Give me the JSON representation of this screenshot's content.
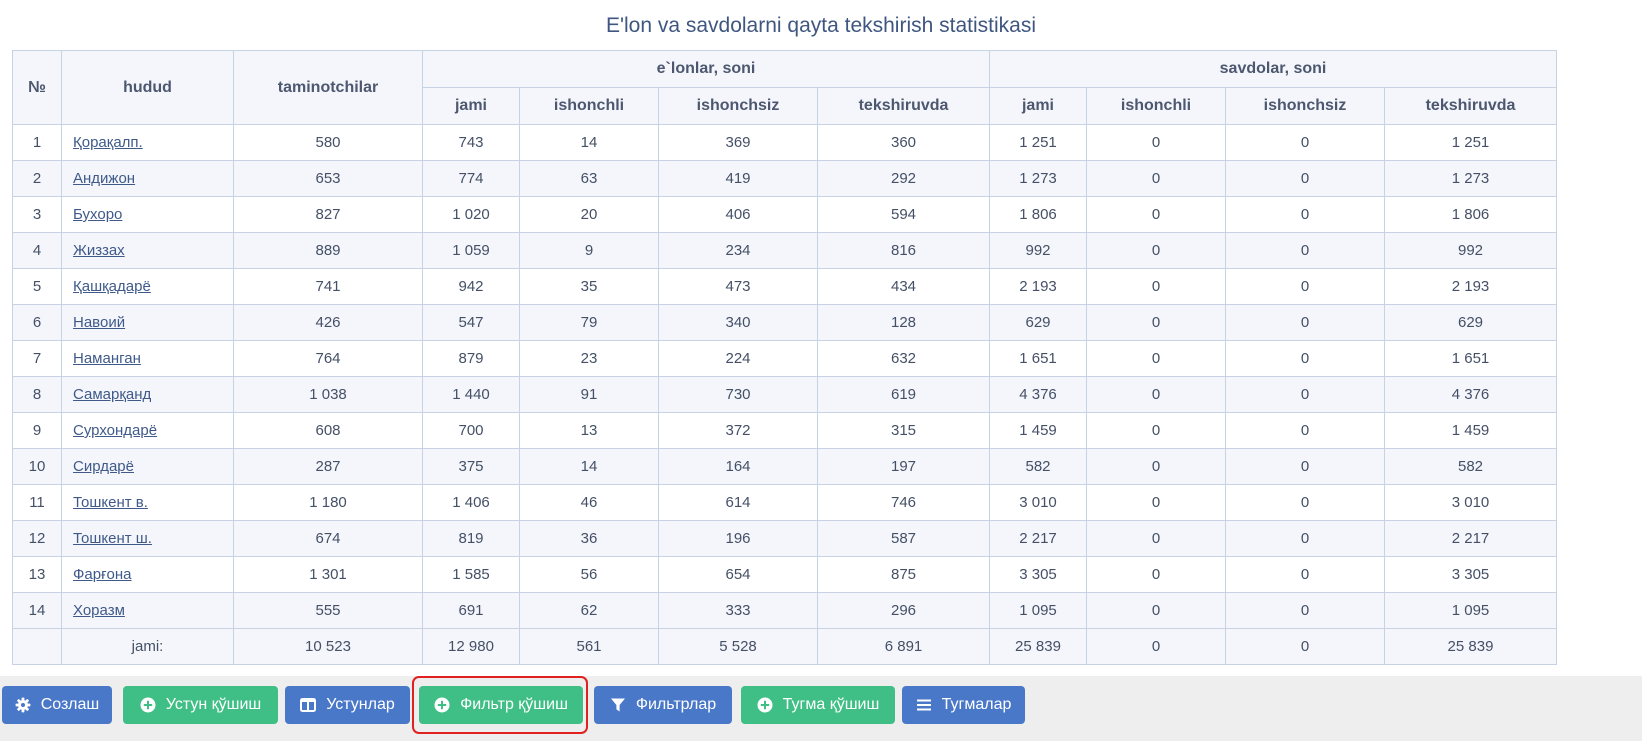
{
  "title": "E'lon va savdolarni qayta tekshirish statistikasi",
  "table": {
    "headers": {
      "num": "№",
      "region": "hudud",
      "suppliers": "taminotchilar",
      "ads_group": "e`lonlar, soni",
      "trades_group": "savdolar, soni",
      "total": "jami",
      "trusted": "ishonchli",
      "untrusted": "ishonchsiz",
      "checking": "tekshiruvda"
    },
    "rows": [
      {
        "n": "1",
        "region": "Қорақалп.",
        "suppliers": "580",
        "ads": [
          "743",
          "14",
          "369",
          "360"
        ],
        "trades": [
          "1 251",
          "0",
          "0",
          "1 251"
        ]
      },
      {
        "n": "2",
        "region": "Андижон",
        "suppliers": "653",
        "ads": [
          "774",
          "63",
          "419",
          "292"
        ],
        "trades": [
          "1 273",
          "0",
          "0",
          "1 273"
        ]
      },
      {
        "n": "3",
        "region": "Бухоро",
        "suppliers": "827",
        "ads": [
          "1 020",
          "20",
          "406",
          "594"
        ],
        "trades": [
          "1 806",
          "0",
          "0",
          "1 806"
        ]
      },
      {
        "n": "4",
        "region": "Жиззах",
        "suppliers": "889",
        "ads": [
          "1 059",
          "9",
          "234",
          "816"
        ],
        "trades": [
          "992",
          "0",
          "0",
          "992"
        ]
      },
      {
        "n": "5",
        "region": "Қашқадарё",
        "suppliers": "741",
        "ads": [
          "942",
          "35",
          "473",
          "434"
        ],
        "trades": [
          "2 193",
          "0",
          "0",
          "2 193"
        ]
      },
      {
        "n": "6",
        "region": "Навоий",
        "suppliers": "426",
        "ads": [
          "547",
          "79",
          "340",
          "128"
        ],
        "trades": [
          "629",
          "0",
          "0",
          "629"
        ]
      },
      {
        "n": "7",
        "region": "Наманган",
        "suppliers": "764",
        "ads": [
          "879",
          "23",
          "224",
          "632"
        ],
        "trades": [
          "1 651",
          "0",
          "0",
          "1 651"
        ]
      },
      {
        "n": "8",
        "region": "Самарқанд",
        "suppliers": "1 038",
        "ads": [
          "1 440",
          "91",
          "730",
          "619"
        ],
        "trades": [
          "4 376",
          "0",
          "0",
          "4 376"
        ]
      },
      {
        "n": "9",
        "region": "Сурхондарё",
        "suppliers": "608",
        "ads": [
          "700",
          "13",
          "372",
          "315"
        ],
        "trades": [
          "1 459",
          "0",
          "0",
          "1 459"
        ]
      },
      {
        "n": "10",
        "region": "Сирдарё",
        "suppliers": "287",
        "ads": [
          "375",
          "14",
          "164",
          "197"
        ],
        "trades": [
          "582",
          "0",
          "0",
          "582"
        ]
      },
      {
        "n": "11",
        "region": "Тошкент в.",
        "suppliers": "1 180",
        "ads": [
          "1 406",
          "46",
          "614",
          "746"
        ],
        "trades": [
          "3 010",
          "0",
          "0",
          "3 010"
        ]
      },
      {
        "n": "12",
        "region": "Тошкент ш.",
        "suppliers": "674",
        "ads": [
          "819",
          "36",
          "196",
          "587"
        ],
        "trades": [
          "2 217",
          "0",
          "0",
          "2 217"
        ]
      },
      {
        "n": "13",
        "region": "Фарғона",
        "suppliers": "1 301",
        "ads": [
          "1 585",
          "56",
          "654",
          "875"
        ],
        "trades": [
          "3 305",
          "0",
          "0",
          "3 305"
        ]
      },
      {
        "n": "14",
        "region": "Хоразм",
        "suppliers": "555",
        "ads": [
          "691",
          "62",
          "333",
          "296"
        ],
        "trades": [
          "1 095",
          "0",
          "0",
          "1 095"
        ]
      }
    ],
    "totals": {
      "label": "jami:",
      "suppliers": "10 523",
      "ads": [
        "12 980",
        "561",
        "5 528",
        "6 891"
      ],
      "trades": [
        "25 839",
        "0",
        "0",
        "25 839"
      ]
    }
  },
  "toolbar": [
    {
      "name": "settings-button",
      "icon": "gear-icon",
      "label": "Созлаш",
      "color": "blue"
    },
    {
      "name": "add-column-button",
      "icon": "plus-circle-icon",
      "label": "Устун қўшиш",
      "color": "green"
    },
    {
      "name": "columns-button",
      "icon": "columns-icon",
      "label": "Устунлар",
      "color": "blue"
    },
    {
      "name": "add-filter-button",
      "icon": "plus-circle-icon",
      "label": "Фильтр қўшиш",
      "color": "green",
      "highlighted": true
    },
    {
      "name": "filters-button",
      "icon": "funnel-icon",
      "label": "Фильтрлар",
      "color": "blue"
    },
    {
      "name": "add-button-button",
      "icon": "plus-circle-icon",
      "label": "Тугма қўшиш",
      "color": "green"
    },
    {
      "name": "buttons-button",
      "icon": "list-icon",
      "label": "Тугмалар",
      "color": "blue"
    }
  ],
  "colors": {
    "blue_button": "#4a78c9",
    "green_button": "#3fbf85",
    "highlight_border": "#e0211f",
    "link": "#3f5a8a"
  }
}
